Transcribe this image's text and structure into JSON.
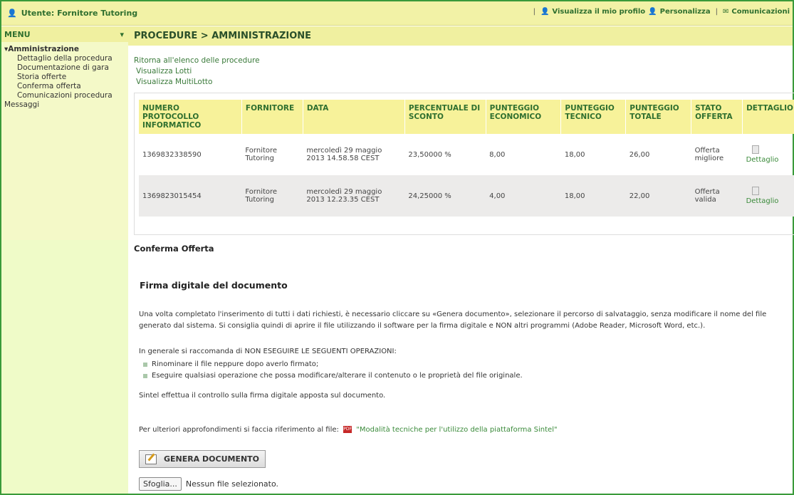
{
  "topbar": {
    "user": "Utente: Fornitore Tutoring",
    "profile": "Visualizza il mio profilo",
    "customize": "Personalizza",
    "comms": "Comunicazioni"
  },
  "sidebar": {
    "menu_label": "MENU",
    "group": "▾Amministrazione",
    "items": [
      "Dettaglio della procedura",
      "Documentazione di gara",
      "Storia offerte",
      "Conferma offerta",
      "Comunicazioni procedura"
    ],
    "messages": "Messaggi"
  },
  "header": {
    "title": "PROCEDURE  > AMMINISTRAZIONE"
  },
  "links": [
    "Ritorna all'elenco delle procedure",
    "Visualizza Lotti",
    "Visualizza MultiLotto"
  ],
  "table": {
    "headers": [
      "NUMERO PROTOCOLLO INFORMATICO",
      "FORNITORE",
      "DATA",
      "PERCENTUALE DI SCONTO",
      "PUNTEGGIO ECONOMICO",
      "PUNTEGGIO TECNICO",
      "PUNTEGGIO TOTALE",
      "STATO OFFERTA",
      "DETTAGLIO"
    ],
    "rows": [
      [
        "1369832338590",
        "Fornitore Tutoring",
        "mercoledì 29 maggio 2013 14.58.58 CEST",
        "23,50000 %",
        "8,00",
        "18,00",
        "26,00",
        "Offerta migliore",
        "Dettaglio"
      ],
      [
        "1369823015454",
        "Fornitore Tutoring",
        "mercoledì 29 maggio 2013 12.23.35 CEST",
        "24,25000 %",
        "4,00",
        "18,00",
        "22,00",
        "Offerta valida",
        "Dettaglio"
      ]
    ]
  },
  "content": {
    "section": "Conferma Offerta",
    "heading": "Firma digitale del documento",
    "para1": "Una volta completato l'inserimento di tutti i dati richiesti, è necessario cliccare su «Genera documento», selezionare il percorso di salvataggio, senza modificare il nome del file generato dal sistema. Si consiglia quindi di aprire il file utilizzando il software per la firma digitale e NON altri programmi (Adobe Reader, Microsoft Word, etc.).",
    "para2": "In generale si raccomanda di NON ESEGUIRE LE SEGUENTI OPERAZIONI:",
    "bullets": [
      "Rinominare il file neppure dopo averlo firmato;",
      "Eseguire qualsiasi operazione che possa modificare/alterare il contenuto o le proprietà del file originale."
    ],
    "para3": "Sintel effettua il controllo sulla firma digitale apposta sul documento.",
    "para4": "Per ulteriori approfondimenti si faccia riferimento al file:",
    "pdf_link": "\"Modalità tecniche per l'utilizzo della piattaforma Sintel\"",
    "button": "GENERA DOCUMENTO",
    "browse": "Sfoglia...",
    "nofile": "Nessun file selezionato."
  }
}
